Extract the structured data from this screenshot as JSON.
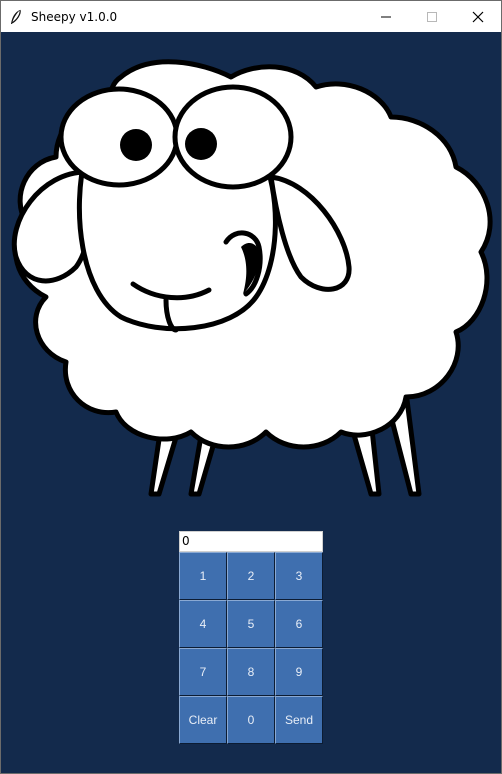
{
  "window": {
    "title": "Sheepy v1.0.0",
    "minimize_icon": "minimize-icon",
    "maximize_icon": "maximize-icon",
    "close_icon": "close-icon",
    "app_icon": "feather-icon"
  },
  "colors": {
    "background": "#132a4c",
    "key": "#3f6faf",
    "key_text": "#e8eef7"
  },
  "display": {
    "value": "0"
  },
  "keypad": {
    "keys": [
      {
        "label": "1"
      },
      {
        "label": "2"
      },
      {
        "label": "3"
      },
      {
        "label": "4"
      },
      {
        "label": "5"
      },
      {
        "label": "6"
      },
      {
        "label": "7"
      },
      {
        "label": "8"
      },
      {
        "label": "9"
      },
      {
        "label": "Clear"
      },
      {
        "label": "0"
      },
      {
        "label": "Send"
      }
    ]
  }
}
